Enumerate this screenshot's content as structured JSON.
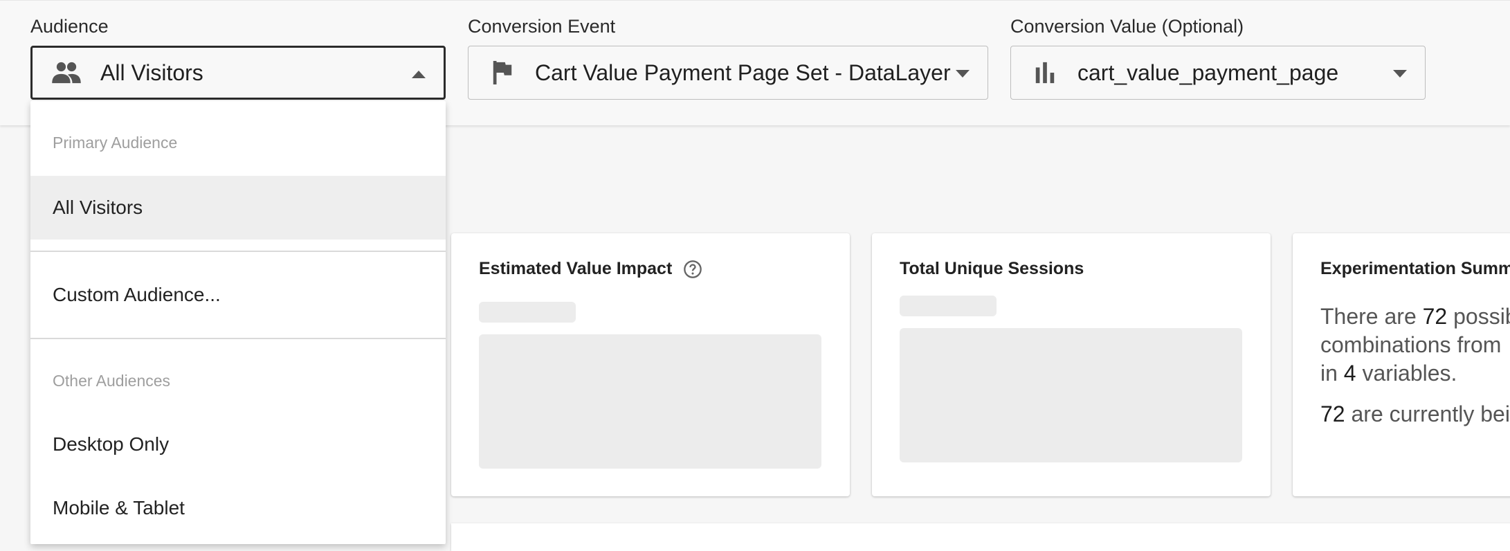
{
  "toolbar": {
    "audience": {
      "label": "Audience",
      "value": "All Visitors",
      "icon": "people-icon"
    },
    "conversion_event": {
      "label": "Conversion Event",
      "value": "Cart Value Payment Page Set - DataLayer",
      "icon": "flag-icon"
    },
    "conversion_value": {
      "label": "Conversion Value (Optional)",
      "value": "cart_value_payment_page",
      "icon": "bar-chart-icon"
    }
  },
  "dropdown": {
    "section_primary": "Primary Audience",
    "item_all_visitors": "All Visitors",
    "item_custom": "Custom Audience...",
    "section_other": "Other Audiences",
    "item_desktop": "Desktop Only",
    "item_mobile": "Mobile & Tablet"
  },
  "cards": {
    "estimated_value": {
      "title": "Estimated Value Impact"
    },
    "sessions": {
      "title": "Total Unique Sessions"
    },
    "summary": {
      "title": "Experimentation Summary",
      "t1": "There are ",
      "n1": "72",
      "t2": " possible",
      "t3": "combinations from",
      "t4": "in ",
      "n2": "4",
      "t5": " variables.",
      "n3": "72",
      "t6": " are currently being"
    }
  },
  "colors": {
    "selected_bg": "#eeeeee",
    "skeleton": "#ececec"
  }
}
